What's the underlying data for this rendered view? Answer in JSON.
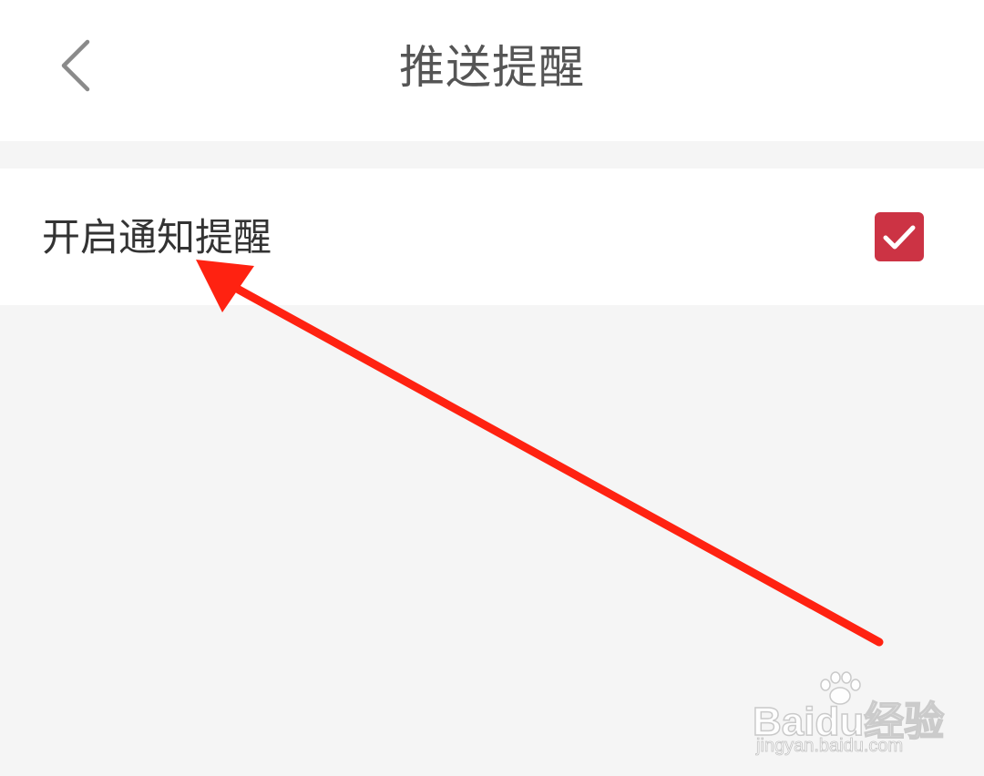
{
  "header": {
    "title": "推送提醒",
    "back_icon": "chevron-left-icon"
  },
  "settings": {
    "notification": {
      "label": "开启通知提醒",
      "checked": true,
      "check_icon": "checkmark-icon"
    }
  },
  "annotation": {
    "arrow_color": "#ff2211"
  },
  "watermark": {
    "logo": "Baidu经验",
    "url": "jingyan.baidu.com"
  },
  "colors": {
    "checkbox_bg": "#cc3344",
    "page_bg": "#f5f5f5",
    "title_text": "#555555",
    "label_text": "#333333"
  }
}
